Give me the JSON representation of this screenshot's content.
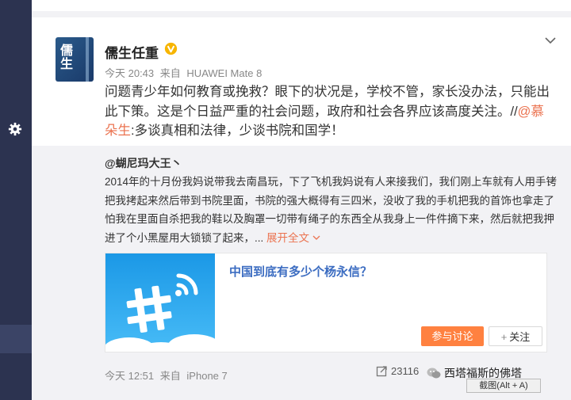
{
  "post": {
    "username": "儒生任重",
    "time": "今天 20:43",
    "from_label": "来自",
    "device": "HUAWEI Mate 8",
    "text_main": "问题青少年如何教育或挽救？眼下的状况是，学校不管，家长没办法，只能出此下策。这是个日益严重的社会问题，政府和社会各界应该高度关注。//",
    "mention": "@慕朵生",
    "text_tail": ":多谈真相和法律，少谈书院和国学！"
  },
  "repost": {
    "username": "@蝴尼玛大王丶",
    "text": "2014年的十月份我妈说带我去南昌玩，下了飞机我妈说有人来接我们，我们刚上车就有人用手铐把我拷起来然后带到书院里面，书院的强大概得有三四米，没收了我的手机把我的首饰也拿走了怕我在里面自杀把我的鞋以及胸罩一切带有绳子的东西全从我身上一件件摘下来，然后就把我押进了个小黑屋用大锁锁了起来，...",
    "expand_label": "展开全文",
    "link_title": "中国到底有多少个杨永信？",
    "discuss_label": "参与讨论",
    "follow_label": "关注",
    "time": "今天 12:51",
    "from_label": "来自",
    "device": "iPhone 7",
    "share_count": "23116",
    "watermark": "西塔福斯的佛塔",
    "popup_text": "截图(Alt + A)"
  },
  "colors": {
    "accent": "#eb7350",
    "link_title": "#3b6cc1",
    "discuss_btn": "#ff8140",
    "sidebar": "#2c3350",
    "repost_bg": "#f2f2f5"
  },
  "icons": [
    "gear-icon",
    "verified-v-icon",
    "chevron-down-icon",
    "hashtag-wifi-icon",
    "share-icon",
    "wechat-icon"
  ]
}
